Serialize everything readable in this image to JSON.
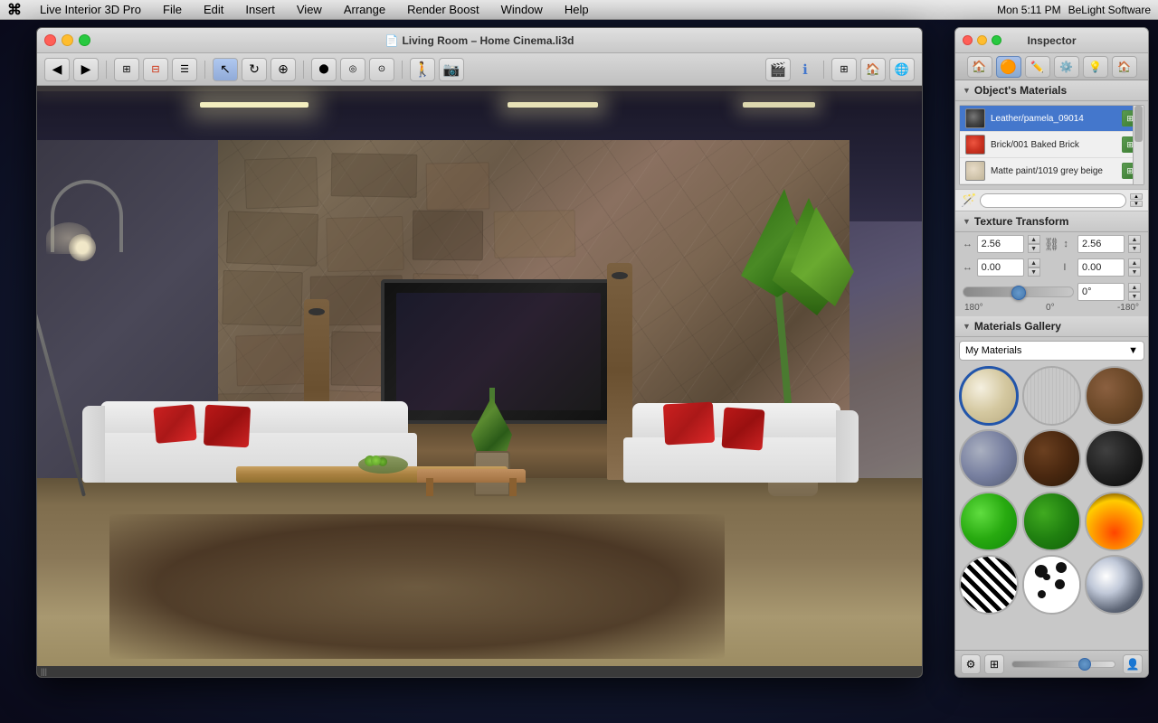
{
  "menubar": {
    "apple": "⌘",
    "items": [
      "Live Interior 3D Pro",
      "File",
      "Edit",
      "Insert",
      "View",
      "Arrange",
      "Render Boost",
      "Window",
      "Help"
    ],
    "right": {
      "time": "Mon 5:11 PM",
      "brand": "BeLight Software"
    }
  },
  "window": {
    "title": "Living Room – Home Cinema.li3d",
    "traffic": [
      "red",
      "yellow",
      "green"
    ]
  },
  "inspector": {
    "title": "Inspector",
    "traffic": [
      "red",
      "yellow",
      "green"
    ],
    "tabs": [
      "🏠",
      "🟠",
      "✏️",
      "⚙️",
      "💡",
      "🏠"
    ],
    "materials_section": {
      "label": "Object's Materials",
      "items": [
        {
          "name": "Leather/pamela_09014",
          "color": "#555555",
          "type": "leather"
        },
        {
          "name": "Brick/001 Baked Brick",
          "color": "#cc3322",
          "type": "brick"
        },
        {
          "name": "Matte paint/1019 grey beige",
          "color": "#d4c8b0",
          "type": "paint"
        }
      ]
    },
    "texture_transform": {
      "label": "Texture Transform",
      "h_value": "2.56",
      "v_value": "2.56",
      "offset_h": "0.00",
      "offset_v": "0.00",
      "rotation": "0°",
      "min_angle": "180°",
      "zero_angle": "0°",
      "max_angle": "-180°"
    },
    "gallery": {
      "label": "Materials Gallery",
      "dropdown_label": "My Materials",
      "items": [
        {
          "id": "cream",
          "label": "Cream",
          "style": "cream"
        },
        {
          "id": "wood-light",
          "label": "Light Wood",
          "style": "wood-light"
        },
        {
          "id": "wood-dark",
          "label": "Dark Wood",
          "style": "wood-dark"
        },
        {
          "id": "metal-light",
          "label": "Light Metal",
          "style": "metal-light"
        },
        {
          "id": "brown-dark",
          "label": "Dark Brown",
          "style": "brown-dark"
        },
        {
          "id": "black",
          "label": "Black",
          "style": "black"
        },
        {
          "id": "green-bright",
          "label": "Bright Green",
          "style": "green-bright"
        },
        {
          "id": "green-dark",
          "label": "Dark Green",
          "style": "green-dark"
        },
        {
          "id": "fire",
          "label": "Fire",
          "style": "fire"
        },
        {
          "id": "zebra",
          "label": "Zebra",
          "style": "zebra"
        },
        {
          "id": "dalmation",
          "label": "Dalmation",
          "style": "dalmation"
        },
        {
          "id": "chrome",
          "label": "Chrome",
          "style": "chrome"
        }
      ]
    }
  },
  "viewport": {
    "scrollbar_text": "|||"
  }
}
